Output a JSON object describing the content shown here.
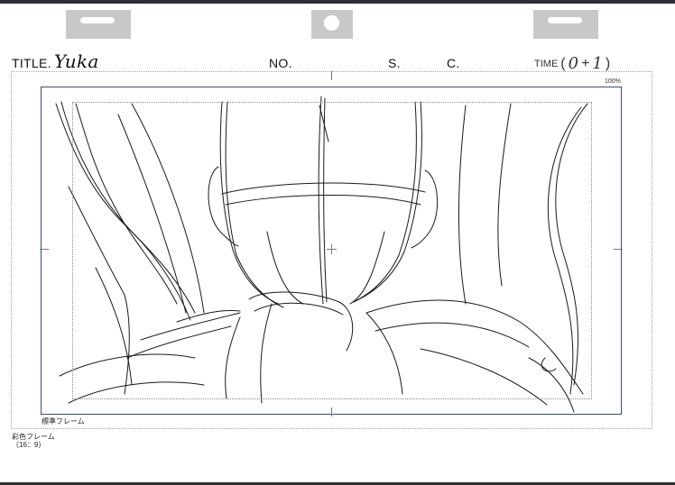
{
  "storyboard": {
    "title_label": "TITLE.",
    "title_value": "Yuka",
    "no_label": "NO.",
    "scene_label": "S.",
    "cut_label": "C.",
    "time_label": "TIME",
    "time_open": "(",
    "time_seconds": "0",
    "time_plus": "+",
    "time_frames": "1",
    "time_close": ")",
    "zoom_percent": "100%",
    "standard_frame_label": "標準フレーム",
    "color_frame_label": "彩色フレーム",
    "color_frame_ratio": "（16：9）"
  },
  "colors": {
    "frame_border": "#3f4a7a",
    "bar": "#2d2f33",
    "peg": "#c8c8c8"
  }
}
